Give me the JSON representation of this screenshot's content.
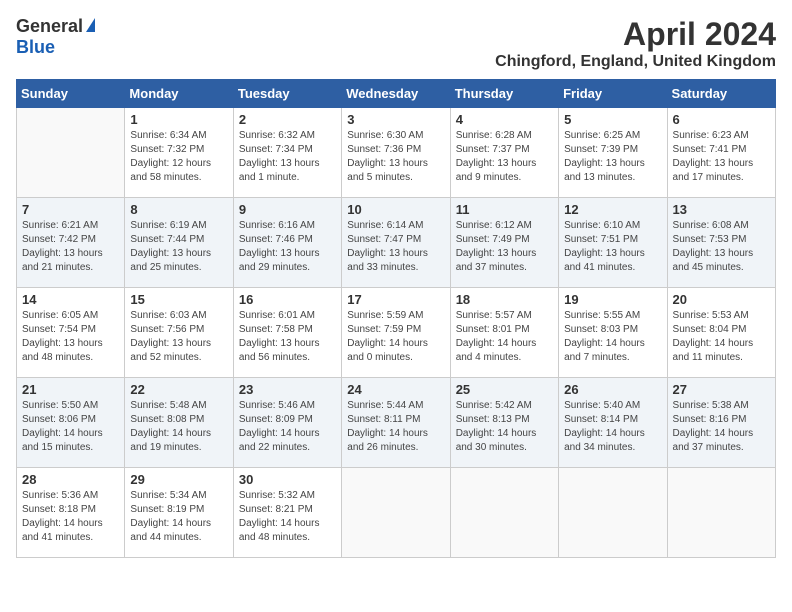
{
  "header": {
    "logo_general": "General",
    "logo_blue": "Blue",
    "month_year": "April 2024",
    "location": "Chingford, England, United Kingdom"
  },
  "calendar": {
    "days_of_week": [
      "Sunday",
      "Monday",
      "Tuesday",
      "Wednesday",
      "Thursday",
      "Friday",
      "Saturday"
    ],
    "weeks": [
      [
        {
          "day": "",
          "sunrise": "",
          "sunset": "",
          "daylight": ""
        },
        {
          "day": "1",
          "sunrise": "Sunrise: 6:34 AM",
          "sunset": "Sunset: 7:32 PM",
          "daylight": "Daylight: 12 hours and 58 minutes."
        },
        {
          "day": "2",
          "sunrise": "Sunrise: 6:32 AM",
          "sunset": "Sunset: 7:34 PM",
          "daylight": "Daylight: 13 hours and 1 minute."
        },
        {
          "day": "3",
          "sunrise": "Sunrise: 6:30 AM",
          "sunset": "Sunset: 7:36 PM",
          "daylight": "Daylight: 13 hours and 5 minutes."
        },
        {
          "day": "4",
          "sunrise": "Sunrise: 6:28 AM",
          "sunset": "Sunset: 7:37 PM",
          "daylight": "Daylight: 13 hours and 9 minutes."
        },
        {
          "day": "5",
          "sunrise": "Sunrise: 6:25 AM",
          "sunset": "Sunset: 7:39 PM",
          "daylight": "Daylight: 13 hours and 13 minutes."
        },
        {
          "day": "6",
          "sunrise": "Sunrise: 6:23 AM",
          "sunset": "Sunset: 7:41 PM",
          "daylight": "Daylight: 13 hours and 17 minutes."
        }
      ],
      [
        {
          "day": "7",
          "sunrise": "Sunrise: 6:21 AM",
          "sunset": "Sunset: 7:42 PM",
          "daylight": "Daylight: 13 hours and 21 minutes."
        },
        {
          "day": "8",
          "sunrise": "Sunrise: 6:19 AM",
          "sunset": "Sunset: 7:44 PM",
          "daylight": "Daylight: 13 hours and 25 minutes."
        },
        {
          "day": "9",
          "sunrise": "Sunrise: 6:16 AM",
          "sunset": "Sunset: 7:46 PM",
          "daylight": "Daylight: 13 hours and 29 minutes."
        },
        {
          "day": "10",
          "sunrise": "Sunrise: 6:14 AM",
          "sunset": "Sunset: 7:47 PM",
          "daylight": "Daylight: 13 hours and 33 minutes."
        },
        {
          "day": "11",
          "sunrise": "Sunrise: 6:12 AM",
          "sunset": "Sunset: 7:49 PM",
          "daylight": "Daylight: 13 hours and 37 minutes."
        },
        {
          "day": "12",
          "sunrise": "Sunrise: 6:10 AM",
          "sunset": "Sunset: 7:51 PM",
          "daylight": "Daylight: 13 hours and 41 minutes."
        },
        {
          "day": "13",
          "sunrise": "Sunrise: 6:08 AM",
          "sunset": "Sunset: 7:53 PM",
          "daylight": "Daylight: 13 hours and 45 minutes."
        }
      ],
      [
        {
          "day": "14",
          "sunrise": "Sunrise: 6:05 AM",
          "sunset": "Sunset: 7:54 PM",
          "daylight": "Daylight: 13 hours and 48 minutes."
        },
        {
          "day": "15",
          "sunrise": "Sunrise: 6:03 AM",
          "sunset": "Sunset: 7:56 PM",
          "daylight": "Daylight: 13 hours and 52 minutes."
        },
        {
          "day": "16",
          "sunrise": "Sunrise: 6:01 AM",
          "sunset": "Sunset: 7:58 PM",
          "daylight": "Daylight: 13 hours and 56 minutes."
        },
        {
          "day": "17",
          "sunrise": "Sunrise: 5:59 AM",
          "sunset": "Sunset: 7:59 PM",
          "daylight": "Daylight: 14 hours and 0 minutes."
        },
        {
          "day": "18",
          "sunrise": "Sunrise: 5:57 AM",
          "sunset": "Sunset: 8:01 PM",
          "daylight": "Daylight: 14 hours and 4 minutes."
        },
        {
          "day": "19",
          "sunrise": "Sunrise: 5:55 AM",
          "sunset": "Sunset: 8:03 PM",
          "daylight": "Daylight: 14 hours and 7 minutes."
        },
        {
          "day": "20",
          "sunrise": "Sunrise: 5:53 AM",
          "sunset": "Sunset: 8:04 PM",
          "daylight": "Daylight: 14 hours and 11 minutes."
        }
      ],
      [
        {
          "day": "21",
          "sunrise": "Sunrise: 5:50 AM",
          "sunset": "Sunset: 8:06 PM",
          "daylight": "Daylight: 14 hours and 15 minutes."
        },
        {
          "day": "22",
          "sunrise": "Sunrise: 5:48 AM",
          "sunset": "Sunset: 8:08 PM",
          "daylight": "Daylight: 14 hours and 19 minutes."
        },
        {
          "day": "23",
          "sunrise": "Sunrise: 5:46 AM",
          "sunset": "Sunset: 8:09 PM",
          "daylight": "Daylight: 14 hours and 22 minutes."
        },
        {
          "day": "24",
          "sunrise": "Sunrise: 5:44 AM",
          "sunset": "Sunset: 8:11 PM",
          "daylight": "Daylight: 14 hours and 26 minutes."
        },
        {
          "day": "25",
          "sunrise": "Sunrise: 5:42 AM",
          "sunset": "Sunset: 8:13 PM",
          "daylight": "Daylight: 14 hours and 30 minutes."
        },
        {
          "day": "26",
          "sunrise": "Sunrise: 5:40 AM",
          "sunset": "Sunset: 8:14 PM",
          "daylight": "Daylight: 14 hours and 34 minutes."
        },
        {
          "day": "27",
          "sunrise": "Sunrise: 5:38 AM",
          "sunset": "Sunset: 8:16 PM",
          "daylight": "Daylight: 14 hours and 37 minutes."
        }
      ],
      [
        {
          "day": "28",
          "sunrise": "Sunrise: 5:36 AM",
          "sunset": "Sunset: 8:18 PM",
          "daylight": "Daylight: 14 hours and 41 minutes."
        },
        {
          "day": "29",
          "sunrise": "Sunrise: 5:34 AM",
          "sunset": "Sunset: 8:19 PM",
          "daylight": "Daylight: 14 hours and 44 minutes."
        },
        {
          "day": "30",
          "sunrise": "Sunrise: 5:32 AM",
          "sunset": "Sunset: 8:21 PM",
          "daylight": "Daylight: 14 hours and 48 minutes."
        },
        {
          "day": "",
          "sunrise": "",
          "sunset": "",
          "daylight": ""
        },
        {
          "day": "",
          "sunrise": "",
          "sunset": "",
          "daylight": ""
        },
        {
          "day": "",
          "sunrise": "",
          "sunset": "",
          "daylight": ""
        },
        {
          "day": "",
          "sunrise": "",
          "sunset": "",
          "daylight": ""
        }
      ]
    ]
  }
}
